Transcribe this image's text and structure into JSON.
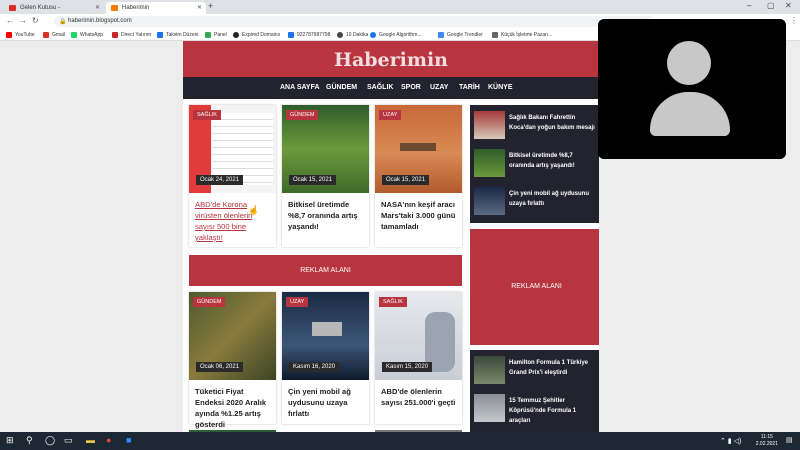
{
  "browser": {
    "tabs": [
      {
        "label": "Gelen Kutusu - kadir@imza.com",
        "color": "#d93025"
      },
      {
        "label": "Haberimin",
        "color": "#f57c00"
      }
    ],
    "new_tab": "+",
    "url": "haberimin.blogspot.com",
    "bookmarks": [
      {
        "label": "YouTube",
        "color": "#ff0000"
      },
      {
        "label": "Gmail",
        "color": "#d93025"
      },
      {
        "label": "WhatsApp",
        "color": "#25d366"
      },
      {
        "label": "Direct Yatırım",
        "color": "#c62828"
      },
      {
        "label": "Takvim Düzeni",
        "color": "#1a73e8"
      },
      {
        "label": "Panel",
        "color": "#34a853"
      },
      {
        "label": "Expired Domains",
        "color": "#222222"
      },
      {
        "label": "922787987798",
        "color": "#1a73e8"
      },
      {
        "label": "10 Dakika",
        "color": "#444444"
      },
      {
        "label": "Google Algorithm...",
        "color": "#1a73e8"
      },
      {
        "label": "Google Trendler",
        "color": "#4285f4"
      },
      {
        "label": "Küçük İşletme Pazarı...",
        "color": "#666666"
      }
    ]
  },
  "site": {
    "logo": "Haberimin",
    "nav": [
      "ANA SAYFA",
      "GÜNDEM",
      "SAĞLIK",
      "SPOR",
      "UZAY",
      "TARİH",
      "KÜNYE"
    ],
    "cards_row1": [
      {
        "category": "SAĞLIK",
        "date": "Ocak 24, 2021",
        "title": "ABD'de Korona virüsten ölenlerin sayısı 500 bine yaklaştı!"
      },
      {
        "category": "GÜNDEM",
        "date": "Ocak 15, 2021",
        "title": "Bitkisel üretimde %8,7 oranında artış yaşandı!"
      },
      {
        "category": "UZAY",
        "date": "Ocak 15, 2021",
        "title": "NASA'nın keşif aracı Mars'taki 3.000 günü tamamladı"
      }
    ],
    "ad_label": "REKLAM ALANI",
    "cards_row2": [
      {
        "category": "GÜNDEM",
        "date": "Ocak 06, 2021",
        "title": "Tüketici Fiyat Endeksi 2020 Aralık ayında %1.25 artış gösterdi"
      },
      {
        "category": "UZAY",
        "date": "Kasım 16, 2020",
        "title": "Çin yeni mobil ağ uydusunu uzaya fırlattı"
      },
      {
        "category": "SAĞLIK",
        "date": "Kasım 15, 2020",
        "title": "ABD'de ölenlerin sayısı 251.000'i geçti"
      }
    ],
    "sidebar_top": [
      "Sağlık Bakanı Fahrettin Koca'dan yoğun bakım mesajı",
      "Bitkisel üretimde %8,7 oranında artış yaşandı!",
      "Çin yeni mobil ağ uydusunu uzaya fırlattı"
    ],
    "sidebar_ad": "REKLAM ALANI",
    "sidebar_bottom": [
      "Hamilton Formula 1 Türkiye Grand Prix'i eleştirdi",
      "15 Temmuz Şehitler Köprüsü'nde Formula 1 araçları"
    ]
  },
  "taskbar": {
    "time": "11:15",
    "date": "2.02.2021"
  },
  "colors": {
    "brand": "#b8343f",
    "nav": "#23232f"
  }
}
